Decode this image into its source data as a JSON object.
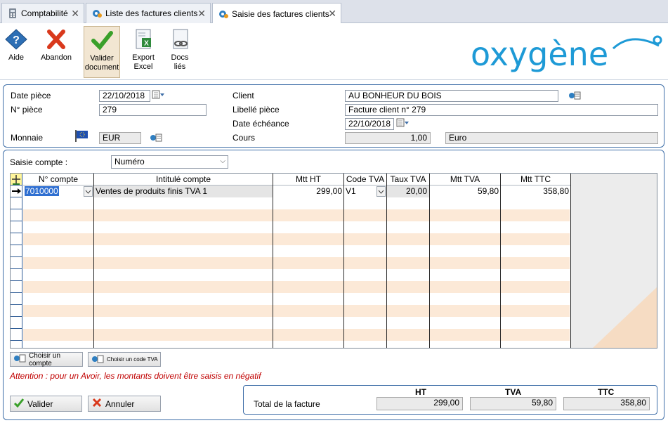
{
  "tabs": [
    {
      "label": "Comptabilité",
      "icon": "calculator-icon"
    },
    {
      "label": "Liste des factures clients",
      "icon": "gears-icon"
    },
    {
      "label": "Saisie des factures clients",
      "icon": "gears-icon"
    }
  ],
  "toolbar": {
    "help": "Aide",
    "cancel": "Abandon",
    "validate_line1": "Valider",
    "validate_line2": "document",
    "export_line1": "Export",
    "export_line2": "Excel",
    "docs_line1": "Docs",
    "docs_line2": "liés"
  },
  "brand": {
    "logo_text": "oxygène",
    "color": "#1e9ad6"
  },
  "header": {
    "date_piece_label": "Date pièce",
    "date_piece": "22/10/2018",
    "num_piece_label": "N° pièce",
    "num_piece": "279",
    "monnaie_label": "Monnaie",
    "monnaie": "EUR",
    "client_label": "Client",
    "client": "AU BONHEUR DU BOIS",
    "libelle_label": "Libellé pièce",
    "libelle": "Facture client n° 279",
    "echeance_label": "Date échéance",
    "echeance": "22/10/2018",
    "cours_label": "Cours",
    "cours": "1,00",
    "devise": "Euro"
  },
  "saisie": {
    "label": "Saisie compte :",
    "value": "Numéro"
  },
  "grid": {
    "columns": [
      "N° compte",
      "Intitulé compte",
      "Mtt HT",
      "Code TVA",
      "Taux TVA",
      "Mtt TVA",
      "Mtt TTC"
    ],
    "row": {
      "compte": "7010000",
      "intitule": "Ventes de produits finis TVA 1",
      "mtt_ht": "299,00",
      "code_tva": "V1",
      "taux_tva": "20,00",
      "mtt_tva": "59,80",
      "mtt_ttc": "358,80"
    }
  },
  "actions": {
    "choose_account": "Choisir un compte",
    "choose_vat": "Choisir un code TVA"
  },
  "warning": "Attention : pour un Avoir, les montants doivent être saisis en négatif",
  "footer": {
    "validate": "Valider",
    "cancel": "Annuler"
  },
  "totals": {
    "label": "Total de la facture",
    "ht_label": "HT",
    "tva_label": "TVA",
    "ttc_label": "TTC",
    "ht": "299,00",
    "tva": "59,80",
    "ttc": "358,80"
  },
  "colors": {
    "accent": "#3e6ea8",
    "row_alt": "#fce9d7",
    "warning": "#c00000",
    "validate_green": "#3aa02a",
    "cancel_red": "#d9391c"
  }
}
